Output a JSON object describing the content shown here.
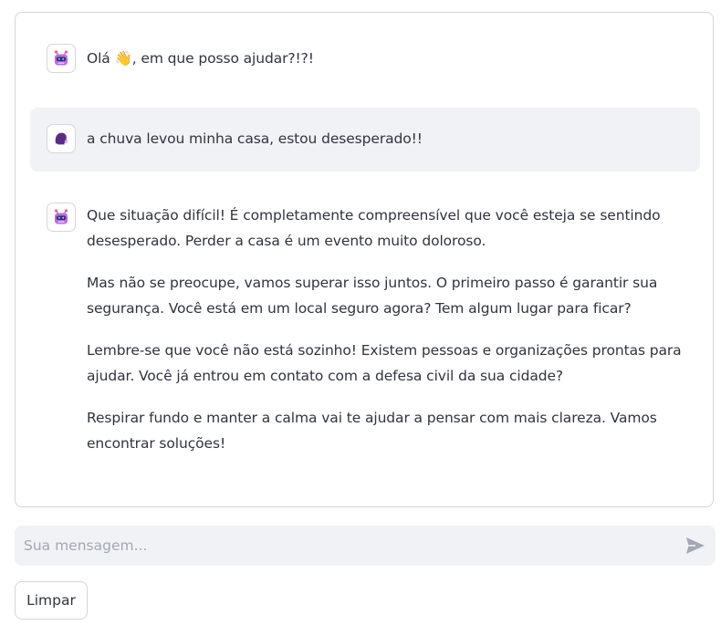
{
  "chat": {
    "messages": [
      {
        "role": "assistant",
        "avatar_icon": "robot-icon",
        "paragraphs": [
          "Olá 👋, em que posso ajudar?!?!"
        ]
      },
      {
        "role": "user",
        "avatar_icon": "user-icon",
        "paragraphs": [
          "a chuva levou minha casa, estou desesperado!!"
        ]
      },
      {
        "role": "assistant",
        "avatar_icon": "robot-icon",
        "paragraphs": [
          "Que situação difícil! É completamente compreensível que você esteja se sentindo desesperado. Perder a casa é um evento muito doloroso.",
          "Mas não se preocupe, vamos superar isso juntos. O primeiro passo é garantir sua segurança. Você está em um local seguro agora? Tem algum lugar para ficar?",
          "Lembre-se que você não está sozinho! Existem pessoas e organizações prontas para ajudar. Você já entrou em contato com a defesa civil da sua cidade?",
          "Respirar fundo e manter a calma vai te ajudar a pensar com mais clareza. Vamos encontrar soluções!"
        ]
      }
    ]
  },
  "input": {
    "placeholder": "Sua mensagem...",
    "value": "",
    "send_icon": "send-icon"
  },
  "clear_button": {
    "label": "Limpar"
  },
  "colors": {
    "user_bubble_bg": "#f0f2f6",
    "input_bg": "#f0f2f6",
    "border": "#d6d6d9",
    "text": "#31333f",
    "placeholder": "#a3a8b4",
    "user_avatar": "#5b2a86"
  }
}
